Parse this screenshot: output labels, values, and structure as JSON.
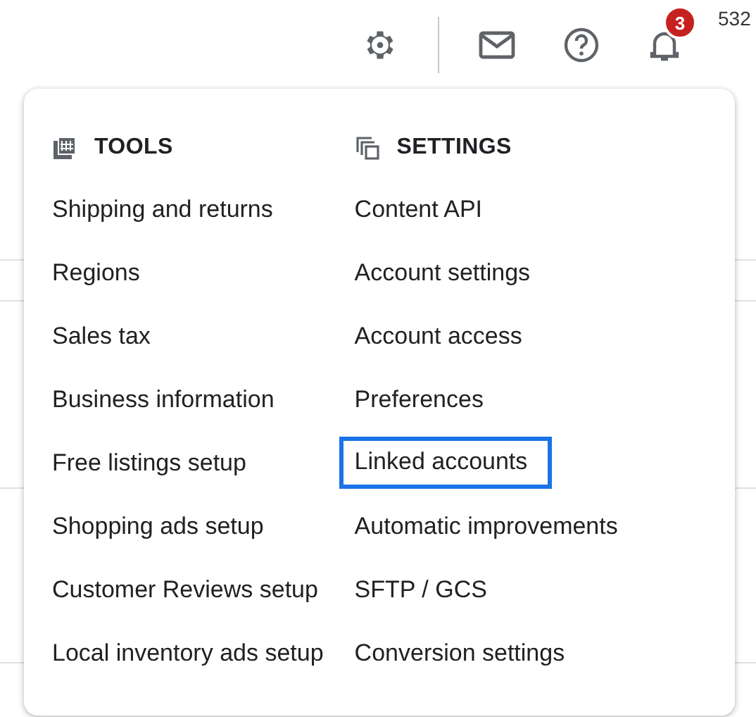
{
  "topbar": {
    "notification_count": "3",
    "corner_text": "532"
  },
  "menu": {
    "columns": [
      {
        "heading": "TOOLS",
        "items": [
          {
            "label": "Shipping and returns",
            "selected": false
          },
          {
            "label": "Regions",
            "selected": false
          },
          {
            "label": "Sales tax",
            "selected": false
          },
          {
            "label": "Business information",
            "selected": false
          },
          {
            "label": "Free listings setup",
            "selected": false
          },
          {
            "label": "Shopping ads setup",
            "selected": false
          },
          {
            "label": "Customer Reviews setup",
            "selected": false
          },
          {
            "label": "Local inventory ads setup",
            "selected": false
          }
        ]
      },
      {
        "heading": "SETTINGS",
        "items": [
          {
            "label": "Content API",
            "selected": false
          },
          {
            "label": "Account settings",
            "selected": false
          },
          {
            "label": "Account access",
            "selected": false
          },
          {
            "label": "Preferences",
            "selected": false
          },
          {
            "label": "Linked accounts",
            "selected": true
          },
          {
            "label": "Automatic improvements",
            "selected": false
          },
          {
            "label": "SFTP / GCS",
            "selected": false
          },
          {
            "label": "Conversion settings",
            "selected": false
          }
        ]
      }
    ]
  }
}
